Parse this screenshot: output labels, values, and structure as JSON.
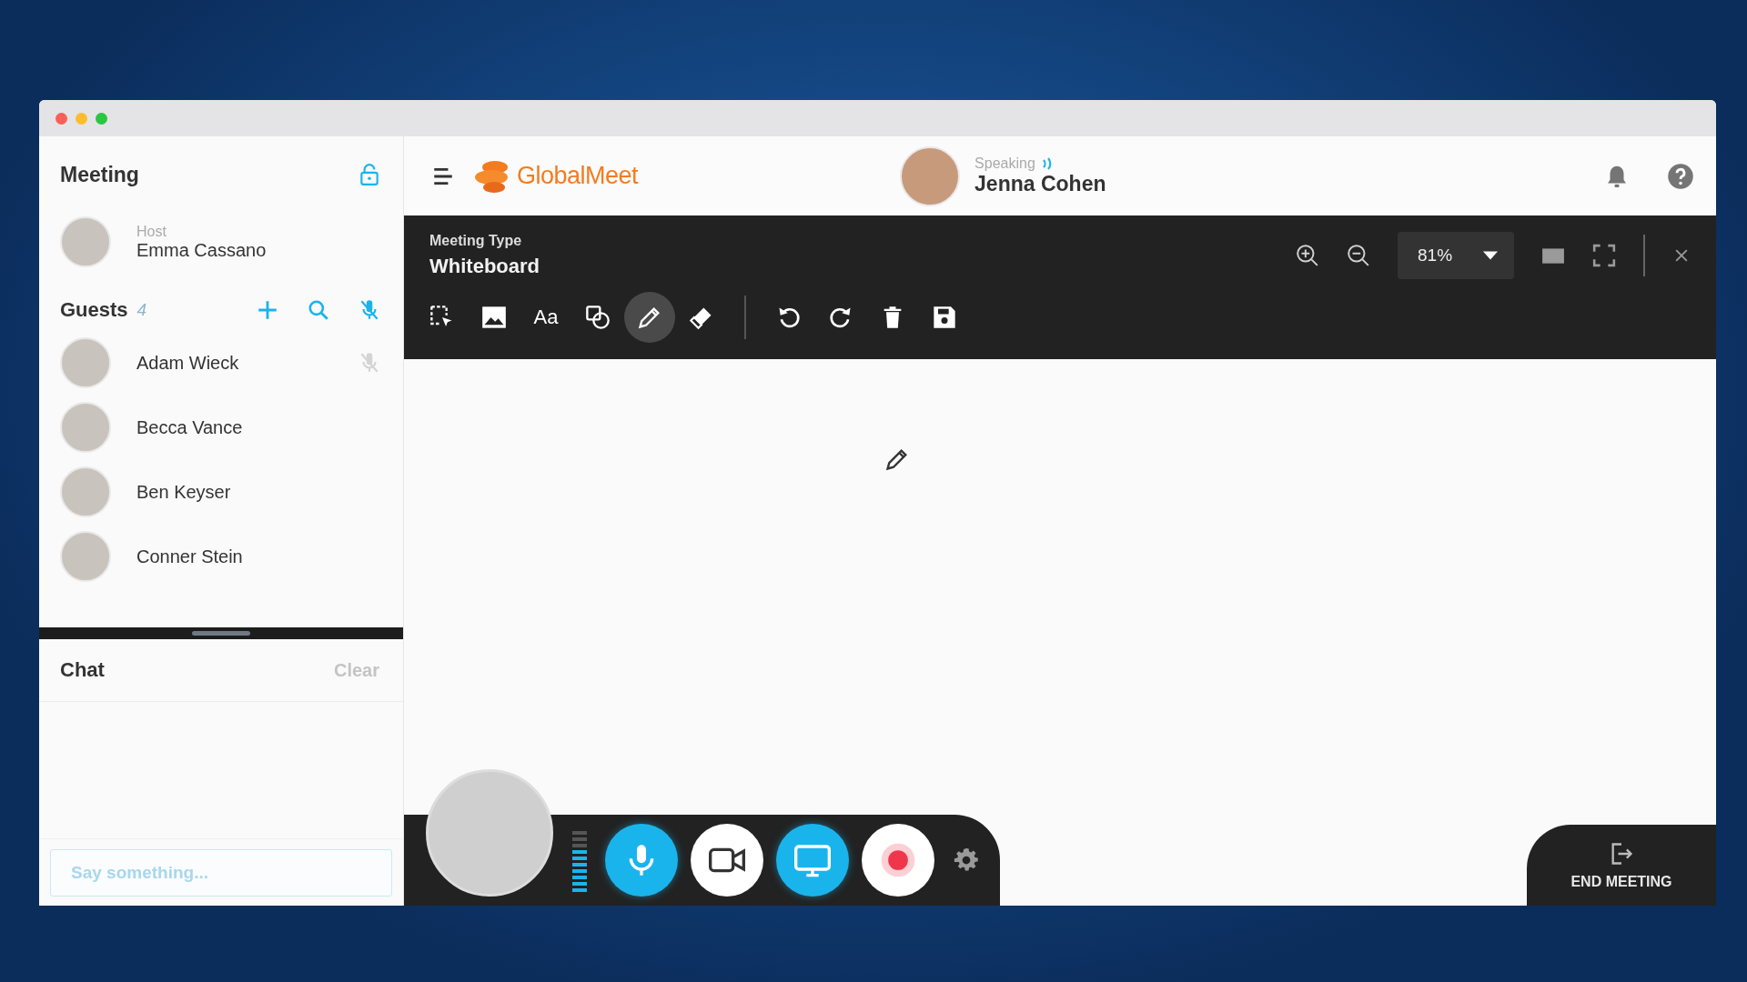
{
  "sidebar": {
    "title": "Meeting",
    "host": {
      "label": "Host",
      "name": "Emma Cassano"
    },
    "guests": {
      "title": "Guests",
      "count": "4",
      "people": [
        {
          "name": "Adam Wieck",
          "muted": true
        },
        {
          "name": "Becca Vance",
          "muted": false
        },
        {
          "name": "Ben Keyser",
          "muted": false
        },
        {
          "name": "Conner Stein",
          "muted": false
        }
      ]
    },
    "chat": {
      "title": "Chat",
      "clear": "Clear",
      "placeholder": "Say something..."
    }
  },
  "header": {
    "logo": "GlobalMeet",
    "speaker": {
      "label": "Speaking",
      "name": "Jenna Cohen"
    }
  },
  "whiteboard_bar": {
    "type_label": "Meeting Type",
    "type": "Whiteboard",
    "zoom": "81%",
    "tools": [
      {
        "kind": "select",
        "selected": false
      },
      {
        "kind": "image",
        "selected": false
      },
      {
        "kind": "text",
        "label": "Aa",
        "selected": false
      },
      {
        "kind": "shapes",
        "selected": false
      },
      {
        "kind": "pen",
        "selected": true
      },
      {
        "kind": "eraser",
        "selected": false
      }
    ],
    "actions": [
      {
        "kind": "undo"
      },
      {
        "kind": "redo"
      },
      {
        "kind": "delete"
      },
      {
        "kind": "save"
      }
    ]
  },
  "call_controls": {
    "mic_meter": {
      "level": 0.7
    },
    "buttons": [
      {
        "kind": "mic",
        "on": true
      },
      {
        "kind": "camera",
        "on": false
      },
      {
        "kind": "screen",
        "on": true
      },
      {
        "kind": "record",
        "on": false
      }
    ]
  },
  "end_meeting": "END MEETING"
}
